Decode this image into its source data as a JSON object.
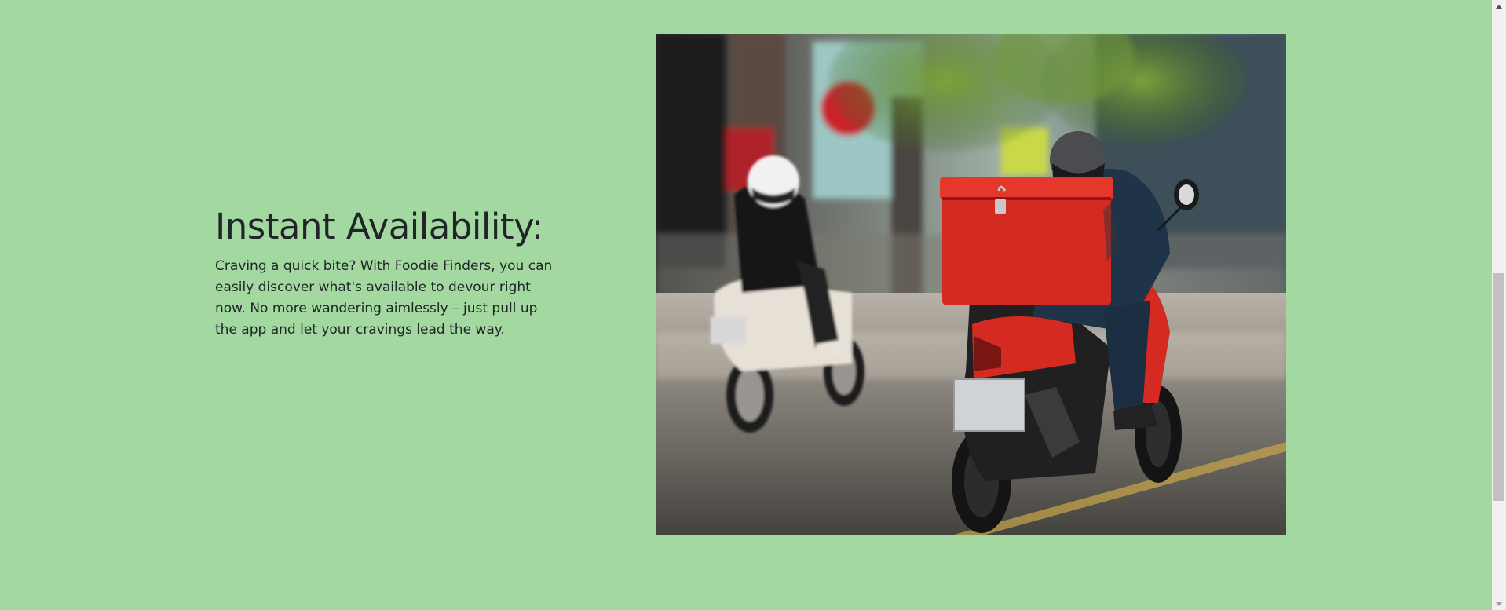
{
  "feature": {
    "heading": "Instant Availability:",
    "description": "Craving a quick bite? With Foodie Finders, you can easily discover what's available to devour right now. No more wandering aimlessly – just pull up the app and let your cravings lead the way."
  },
  "photo": {
    "icon": "delivery-scooters-photo"
  },
  "colors": {
    "background": "#a3d8a0",
    "text": "#212529",
    "scooter_red": "#d42a22"
  }
}
